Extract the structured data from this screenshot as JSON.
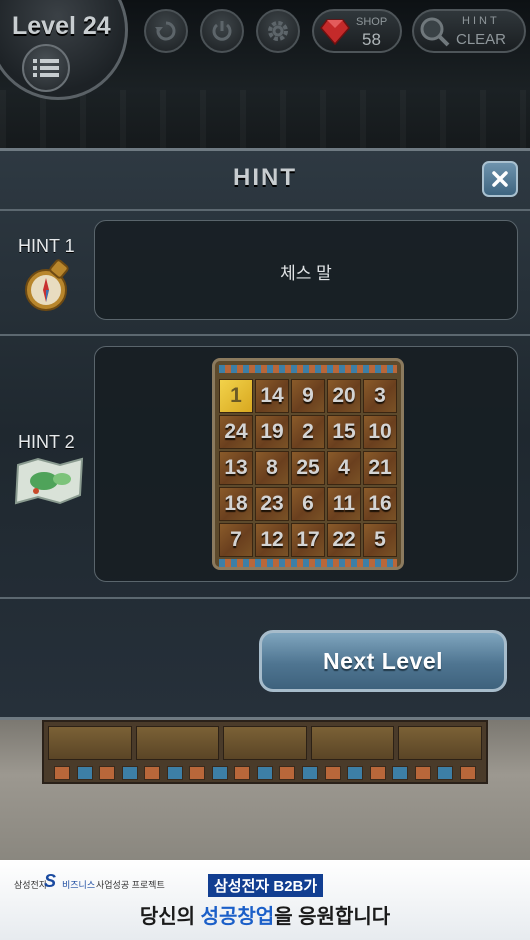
{
  "hud": {
    "level": "Level 24",
    "shop_label": "SHOP",
    "shop_count": "58",
    "hint_label": "HINT",
    "clear_label": "CLEAR"
  },
  "panel": {
    "title": "HINT",
    "close_glyph": "✕",
    "hint1": {
      "label": "HINT 1",
      "text": "체스 말",
      "icon": "compass-icon"
    },
    "hint2": {
      "label": "HINT 2",
      "icon": "treasure-map-icon"
    },
    "next_button": "Next Level"
  },
  "grid": {
    "highlight_index": 0,
    "rows": [
      [
        "1",
        "14",
        "9",
        "20",
        "3"
      ],
      [
        "24",
        "19",
        "2",
        "15",
        "10"
      ],
      [
        "13",
        "8",
        "25",
        "4",
        "21"
      ],
      [
        "18",
        "23",
        "6",
        "11",
        "16"
      ],
      [
        "7",
        "12",
        "17",
        "22",
        "5"
      ]
    ]
  },
  "ad": {
    "company": "삼성전자",
    "logo": "S",
    "biz": "비즈니스",
    "project": "사업성공 프로젝트",
    "tag": "삼성전자 B2B가",
    "main_pre": "당신의 ",
    "main_highlight": "성공창업",
    "main_post": "을 응원합니다"
  },
  "colors": {
    "accent_blue": "#4f7591",
    "highlight_yellow": "#f2d24a",
    "ad_blue": "#1b5fc8"
  }
}
